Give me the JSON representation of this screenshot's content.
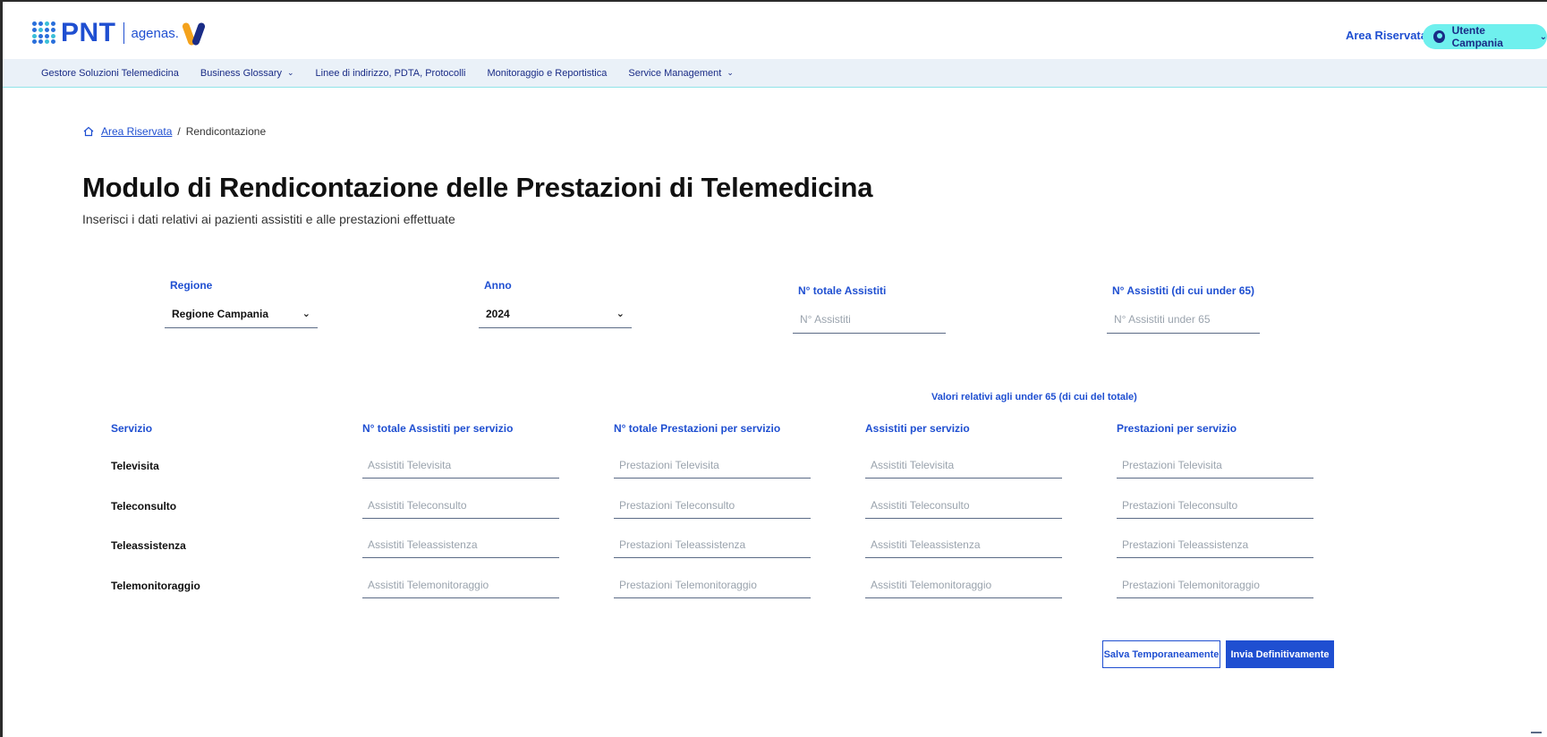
{
  "header": {
    "logo_text": "PNT",
    "logo_partner": "agenas.",
    "area_link": "Area Riservata",
    "user_label": "Utente Campania"
  },
  "nav": [
    {
      "label": "Gestore Soluzioni Telemedicina",
      "dropdown": false
    },
    {
      "label": "Business Glossary",
      "dropdown": true
    },
    {
      "label": "Linee di indirizzo, PDTA, Protocolli",
      "dropdown": false
    },
    {
      "label": "Monitoraggio e Reportistica",
      "dropdown": false
    },
    {
      "label": "Service Management",
      "dropdown": true
    }
  ],
  "breadcrumb": {
    "home_label": "Area Riservata",
    "separator": "/",
    "current": "Rendicontazione"
  },
  "page": {
    "title": "Modulo di Rendicontazione delle Prestazioni di Telemedicina",
    "subtitle": "Inserisci i dati relativi ai pazienti assistiti e alle prestazioni effettuate"
  },
  "form": {
    "regione": {
      "label": "Regione",
      "value": "Regione Campania"
    },
    "anno": {
      "label": "Anno",
      "value": "2024"
    },
    "assistiti": {
      "label": "N° totale Assistiti",
      "placeholder": "N° Assistiti"
    },
    "assistiti_under65": {
      "label": "N° Assistiti (di cui under 65)",
      "placeholder": "N° Assistiti under 65"
    }
  },
  "table": {
    "group_header": "Valori relativi agli under 65 (di cui del totale)",
    "columns": [
      "Servizio",
      "N° totale Assistiti per servizio",
      "N° totale Prestazioni per servizio",
      "Assistiti per servizio",
      "Prestazioni per servizio"
    ],
    "rows": [
      {
        "label": "Televisita",
        "cells": [
          "Assistiti Televisita",
          "Prestazioni Televisita",
          "Assistiti Televisita",
          "Prestazioni Televisita"
        ]
      },
      {
        "label": "Teleconsulto",
        "cells": [
          "Assistiti Teleconsulto",
          "Prestazioni Teleconsulto",
          "Assistiti Teleconsulto",
          "Prestazioni Teleconsulto"
        ]
      },
      {
        "label": "Teleassistenza",
        "cells": [
          "Assistiti Teleassistenza",
          "Prestazioni Teleassistenza",
          "Assistiti Teleassistenza",
          "Prestazioni Teleassistenza"
        ]
      },
      {
        "label": "Telemonitoraggio",
        "cells": [
          "Assistiti Telemonitoraggio",
          "Prestazioni Telemonitoraggio",
          "Assistiti Telemonitoraggio",
          "Prestazioni Telemonitoraggio"
        ]
      }
    ]
  },
  "actions": {
    "save_temp": "Salva Temporaneamente",
    "submit": "Invia Definitivamente"
  },
  "colors": {
    "primary": "#1f4fd1",
    "accent": "#6ff0ee",
    "nav_bg": "#eaf1f8"
  }
}
